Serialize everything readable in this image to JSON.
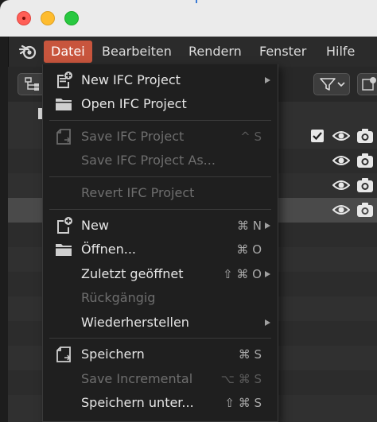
{
  "menubar": {
    "tabs": [
      "Datei",
      "Bearbeiten",
      "Rendern",
      "Fenster",
      "Hilfe"
    ]
  },
  "file_menu": {
    "new_ifc": "New IFC Project",
    "open_ifc": "Open IFC Project",
    "save_ifc": "Save IFC Project",
    "save_ifc_shortcut": "^ S",
    "save_ifc_as": "Save IFC Project As...",
    "revert_ifc": "Revert IFC Project",
    "new": "New",
    "new_shortcut": "⌘ N",
    "open": "Öffnen...",
    "open_shortcut": "⌘ O",
    "recent": "Zuletzt geöffnet",
    "recent_shortcut": "⇧ ⌘ O",
    "revert": "Rückgängig",
    "recover": "Wiederherstellen",
    "save": "Speichern",
    "save_shortcut": "⌘ S",
    "save_incremental": "Save Incremental",
    "save_incremental_shortcut": "⌥ ⌘ S",
    "save_as": "Speichern unter...",
    "save_as_shortcut": "⇧ ⌘ S"
  },
  "colors": {
    "accent": "#c8553d",
    "menu_bg": "#1f1f1f",
    "menubar_bg": "#2b2b2b",
    "disabled_text": "#6e6e6e"
  },
  "icons": [
    "blender-logo-icon",
    "new-file-icon",
    "folder-icon",
    "save-file-icon",
    "filter-icon",
    "eye-icon",
    "camera-icon",
    "checkbox-icon"
  ]
}
